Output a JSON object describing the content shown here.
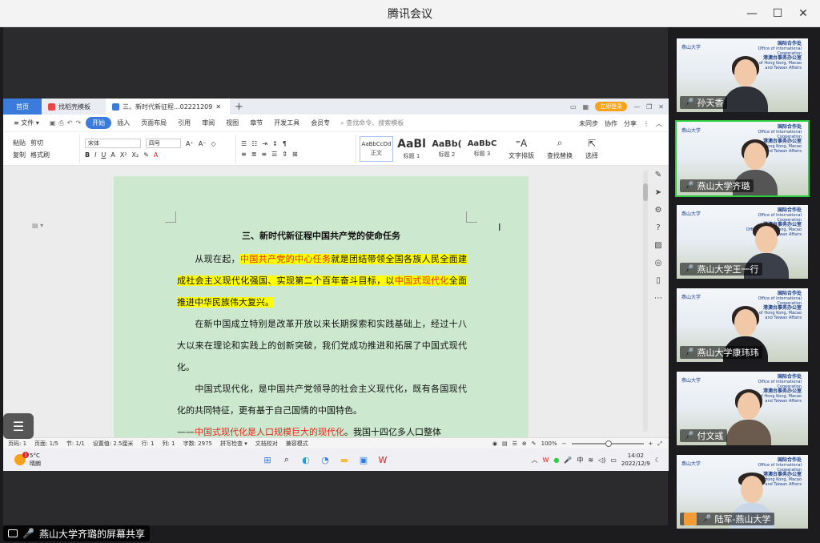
{
  "meeting": {
    "title": "腾讯会议",
    "share_label": "燕山大学齐璐的屏幕共享"
  },
  "window_controls": {
    "minimize": "—",
    "maximize": "☐",
    "close": "✕"
  },
  "wps": {
    "tabs": [
      {
        "label": "首页"
      },
      {
        "label": "找稻壳模板"
      },
      {
        "label": "三、新时代新征程...02221209"
      }
    ],
    "login_label": "立即登录",
    "menu": {
      "file": "≡ 文件 ▾",
      "items": [
        "开始",
        "插入",
        "页面布局",
        "引用",
        "审阅",
        "视图",
        "章节",
        "开发工具",
        "会员专"
      ],
      "search_placeholder": "查找命令、搜索模板",
      "right": [
        "未同步",
        "协作",
        "分享"
      ]
    },
    "ribbon": {
      "paste": "粘贴",
      "cut": "剪切",
      "copy": "复制",
      "format_painter": "格式刷",
      "font_name": "宋体",
      "font_size": "四号",
      "styles": [
        {
          "sample": "AaBbCcDd",
          "name": "正文"
        },
        {
          "sample": "AaBl",
          "name": "标题 1"
        },
        {
          "sample": "AaBb(",
          "name": "标题 2"
        },
        {
          "sample": "AaBbC",
          "name": "标题 3"
        }
      ],
      "text_layout": "文字排版",
      "find_replace": "查找替换",
      "select": "选择"
    },
    "document": {
      "heading": "三、新时代新征程中国共产党的使命任务",
      "p1_a": "从现在起，",
      "p1_b": "中国共产党的中心任务",
      "p1_c": "就是团结带领全国各族人民全面建成社会主义现代化强国、实现第二个百年奋斗目标，以",
      "p1_d": "中国式现代化",
      "p1_e": "全面推进中华民族伟大复兴。",
      "p2": "在新中国成立特别是改革开放以来长期探索和实践基础上，经过十八大以来在理论和实践上的创新突破，我们党成功推进和拓展了中国式现代化。",
      "p3": "中国式现代化，是中国共产党领导的社会主义现代化，既有各国现代化的共同特征，更有基于自己国情的中国特色。",
      "p4_a": "——",
      "p4_b": "中国式现代化是人口规模巨大的现代化",
      "p4_c": "。我国十四亿多人口整体"
    },
    "status": {
      "page_num": "页码: 1",
      "pages": "页面: 1/5",
      "section": "节: 1/1",
      "setting": "设置值: 2.5厘米",
      "row": "行: 1",
      "col": "列: 1",
      "words": "字数: 2975",
      "spell": "拼写检查 ▾",
      "proof": "文档校对",
      "compat": "兼容模式",
      "zoom": "100%"
    }
  },
  "taskbar": {
    "weather_temp": "5°C",
    "weather_desc": "晴朗",
    "weather_badge": "1",
    "time": "14:02",
    "date": "2022/12/9"
  },
  "participants": [
    {
      "name": "孙天香",
      "mic": "off"
    },
    {
      "name": "燕山大学齐璐",
      "mic": "on"
    },
    {
      "name": "燕山大学王一行",
      "mic": "off"
    },
    {
      "name": "燕山大学康玮玮",
      "mic": "off"
    },
    {
      "name": "付文彧",
      "mic": "off"
    },
    {
      "name": "陆军-燕山大学",
      "mic": "off"
    }
  ],
  "tile_org": {
    "cn1": "国际合作处",
    "en1": "Office of International Cooperation",
    "cn2": "港澳台事务办公室",
    "en2": "Office of Hong Kong, Macao and Taiwan Affairs",
    "logo": "燕山大学"
  },
  "colors": {
    "accent": "#3b7bdc",
    "doc_background": "#cce8cf",
    "highlight": "#ffff00",
    "red_text": "#e5261b",
    "speaking_border": "#2ecc40"
  }
}
